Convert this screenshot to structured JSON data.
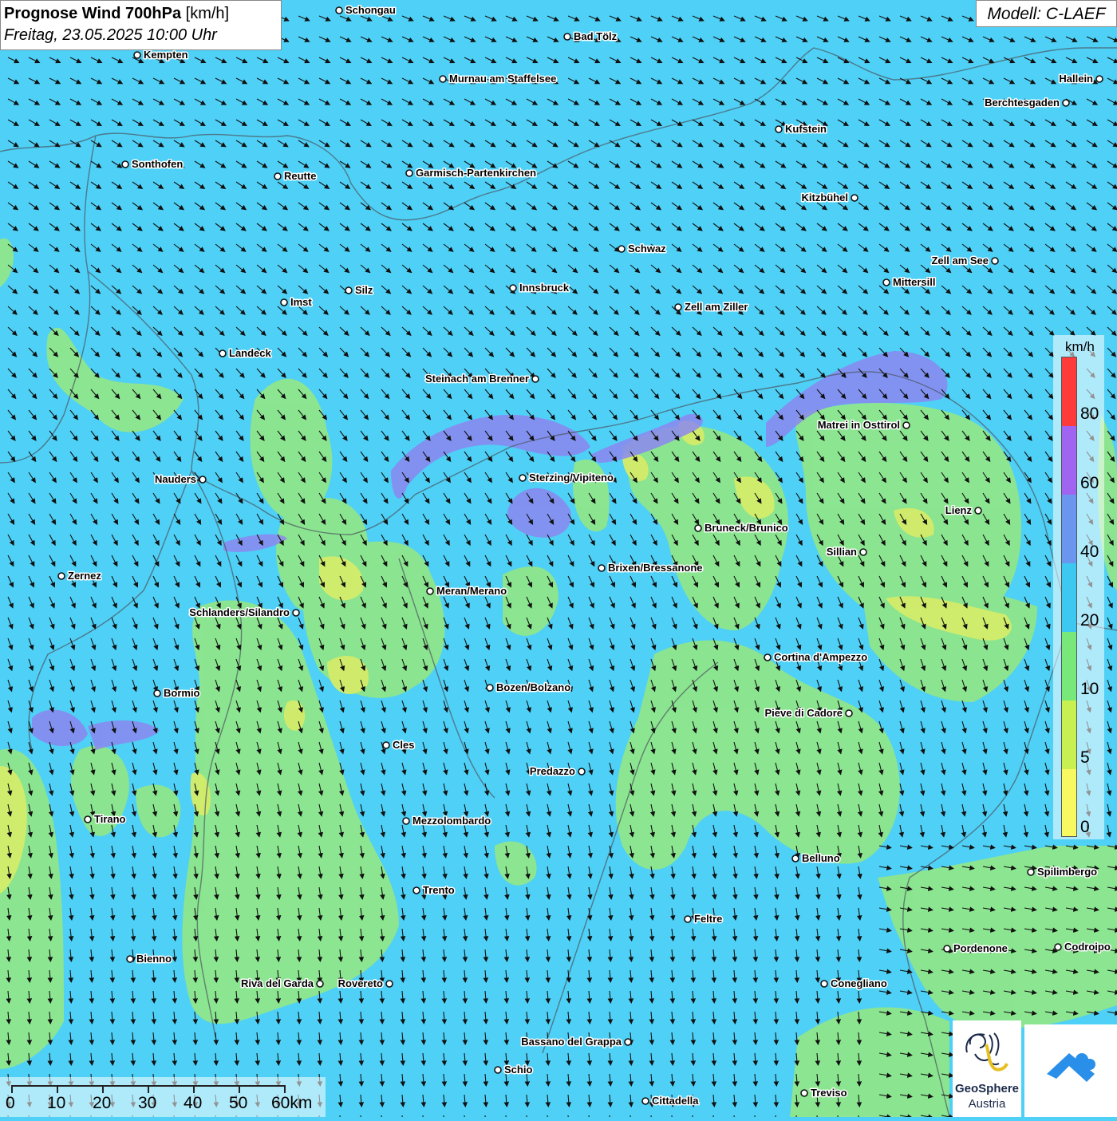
{
  "title": {
    "bold": "Prognose Wind 700hPa",
    "unit": "[km/h]",
    "date": "Freitag, 23.05.2025 10:00 Uhr"
  },
  "model": "Modell: C-LAEF",
  "legend": {
    "unit": "km/h",
    "labels": [
      "80",
      "60",
      "40",
      "20",
      "10",
      "5",
      "0"
    ],
    "colors": [
      "#ff3a3a",
      "#a064f0",
      "#6b96f0",
      "#3cc8f0",
      "#78e87a",
      "#c8f050",
      "#f8f860"
    ]
  },
  "scale": {
    "labels": [
      "0",
      "10",
      "20",
      "30",
      "40",
      "50",
      "60km"
    ]
  },
  "logo": {
    "line1": "GeoSphere",
    "line2": "Austria"
  },
  "cities": [
    {
      "name": "Schongau",
      "label_side": "right"
    },
    {
      "name": "Bad Tölz",
      "label_side": "right"
    },
    {
      "name": "Kempten",
      "label_side": "right"
    },
    {
      "name": "Murnau am Staffelsee",
      "label_side": "right"
    },
    {
      "name": "Hallein",
      "label_side": "left"
    },
    {
      "name": "Berchtesgaden",
      "label_side": "left"
    },
    {
      "name": "Kufstein",
      "label_side": "right"
    },
    {
      "name": "Sonthofen",
      "label_side": "right"
    },
    {
      "name": "Reutte",
      "label_side": "right"
    },
    {
      "name": "Garmisch-Partenkirchen",
      "label_side": "right"
    },
    {
      "name": "Kitzbühel",
      "label_side": "left"
    },
    {
      "name": "Schwaz",
      "label_side": "right"
    },
    {
      "name": "Zell am See",
      "label_side": "left"
    },
    {
      "name": "Mittersill",
      "label_side": "right"
    },
    {
      "name": "Silz",
      "label_side": "right"
    },
    {
      "name": "Innsbruck",
      "label_side": "right"
    },
    {
      "name": "Imst",
      "label_side": "right"
    },
    {
      "name": "Zell am Ziller",
      "label_side": "right"
    },
    {
      "name": "Landeck",
      "label_side": "right"
    },
    {
      "name": "Steinach am Brenner",
      "label_side": "left"
    },
    {
      "name": "Matrei in Osttirol",
      "label_side": "left"
    },
    {
      "name": "Nauders",
      "label_side": "left"
    },
    {
      "name": "Sterzing/Vipiteno",
      "label_side": "right"
    },
    {
      "name": "Lienz",
      "label_side": "left"
    },
    {
      "name": "Bruneck/Brunico",
      "label_side": "right"
    },
    {
      "name": "Sillian",
      "label_side": "left"
    },
    {
      "name": "Zernez",
      "label_side": "right"
    },
    {
      "name": "Brixen/Bressanone",
      "label_side": "right"
    },
    {
      "name": "Meran/Merano",
      "label_side": "right"
    },
    {
      "name": "Schlanders/Silandro",
      "label_side": "left"
    },
    {
      "name": "Cortina d'Ampezzo",
      "label_side": "right"
    },
    {
      "name": "Bormio",
      "label_side": "right"
    },
    {
      "name": "Bozen/Bolzano",
      "label_side": "right"
    },
    {
      "name": "Pieve di Cadore",
      "label_side": "left"
    },
    {
      "name": "Cles",
      "label_side": "right"
    },
    {
      "name": "Predazzo",
      "label_side": "left"
    },
    {
      "name": "Tirano",
      "label_side": "right"
    },
    {
      "name": "Mezzolombardo",
      "label_side": "right"
    },
    {
      "name": "Belluno",
      "label_side": "right"
    },
    {
      "name": "Spilimbergo",
      "label_side": "right"
    },
    {
      "name": "Trento",
      "label_side": "right"
    },
    {
      "name": "Feltre",
      "label_side": "right"
    },
    {
      "name": "Bienno",
      "label_side": "right"
    },
    {
      "name": "Pordenone",
      "label_side": "right"
    },
    {
      "name": "Codroipo",
      "label_side": "right"
    },
    {
      "name": "Riva del Garda",
      "label_side": "left"
    },
    {
      "name": "Rovereto",
      "label_side": "left"
    },
    {
      "name": "Conegliano",
      "label_side": "right"
    },
    {
      "name": "Bassano del Grappa",
      "label_side": "left"
    },
    {
      "name": "Schio",
      "label_side": "right"
    },
    {
      "name": "Treviso",
      "label_side": "right"
    },
    {
      "name": "Cittadella",
      "label_side": "right"
    }
  ]
}
